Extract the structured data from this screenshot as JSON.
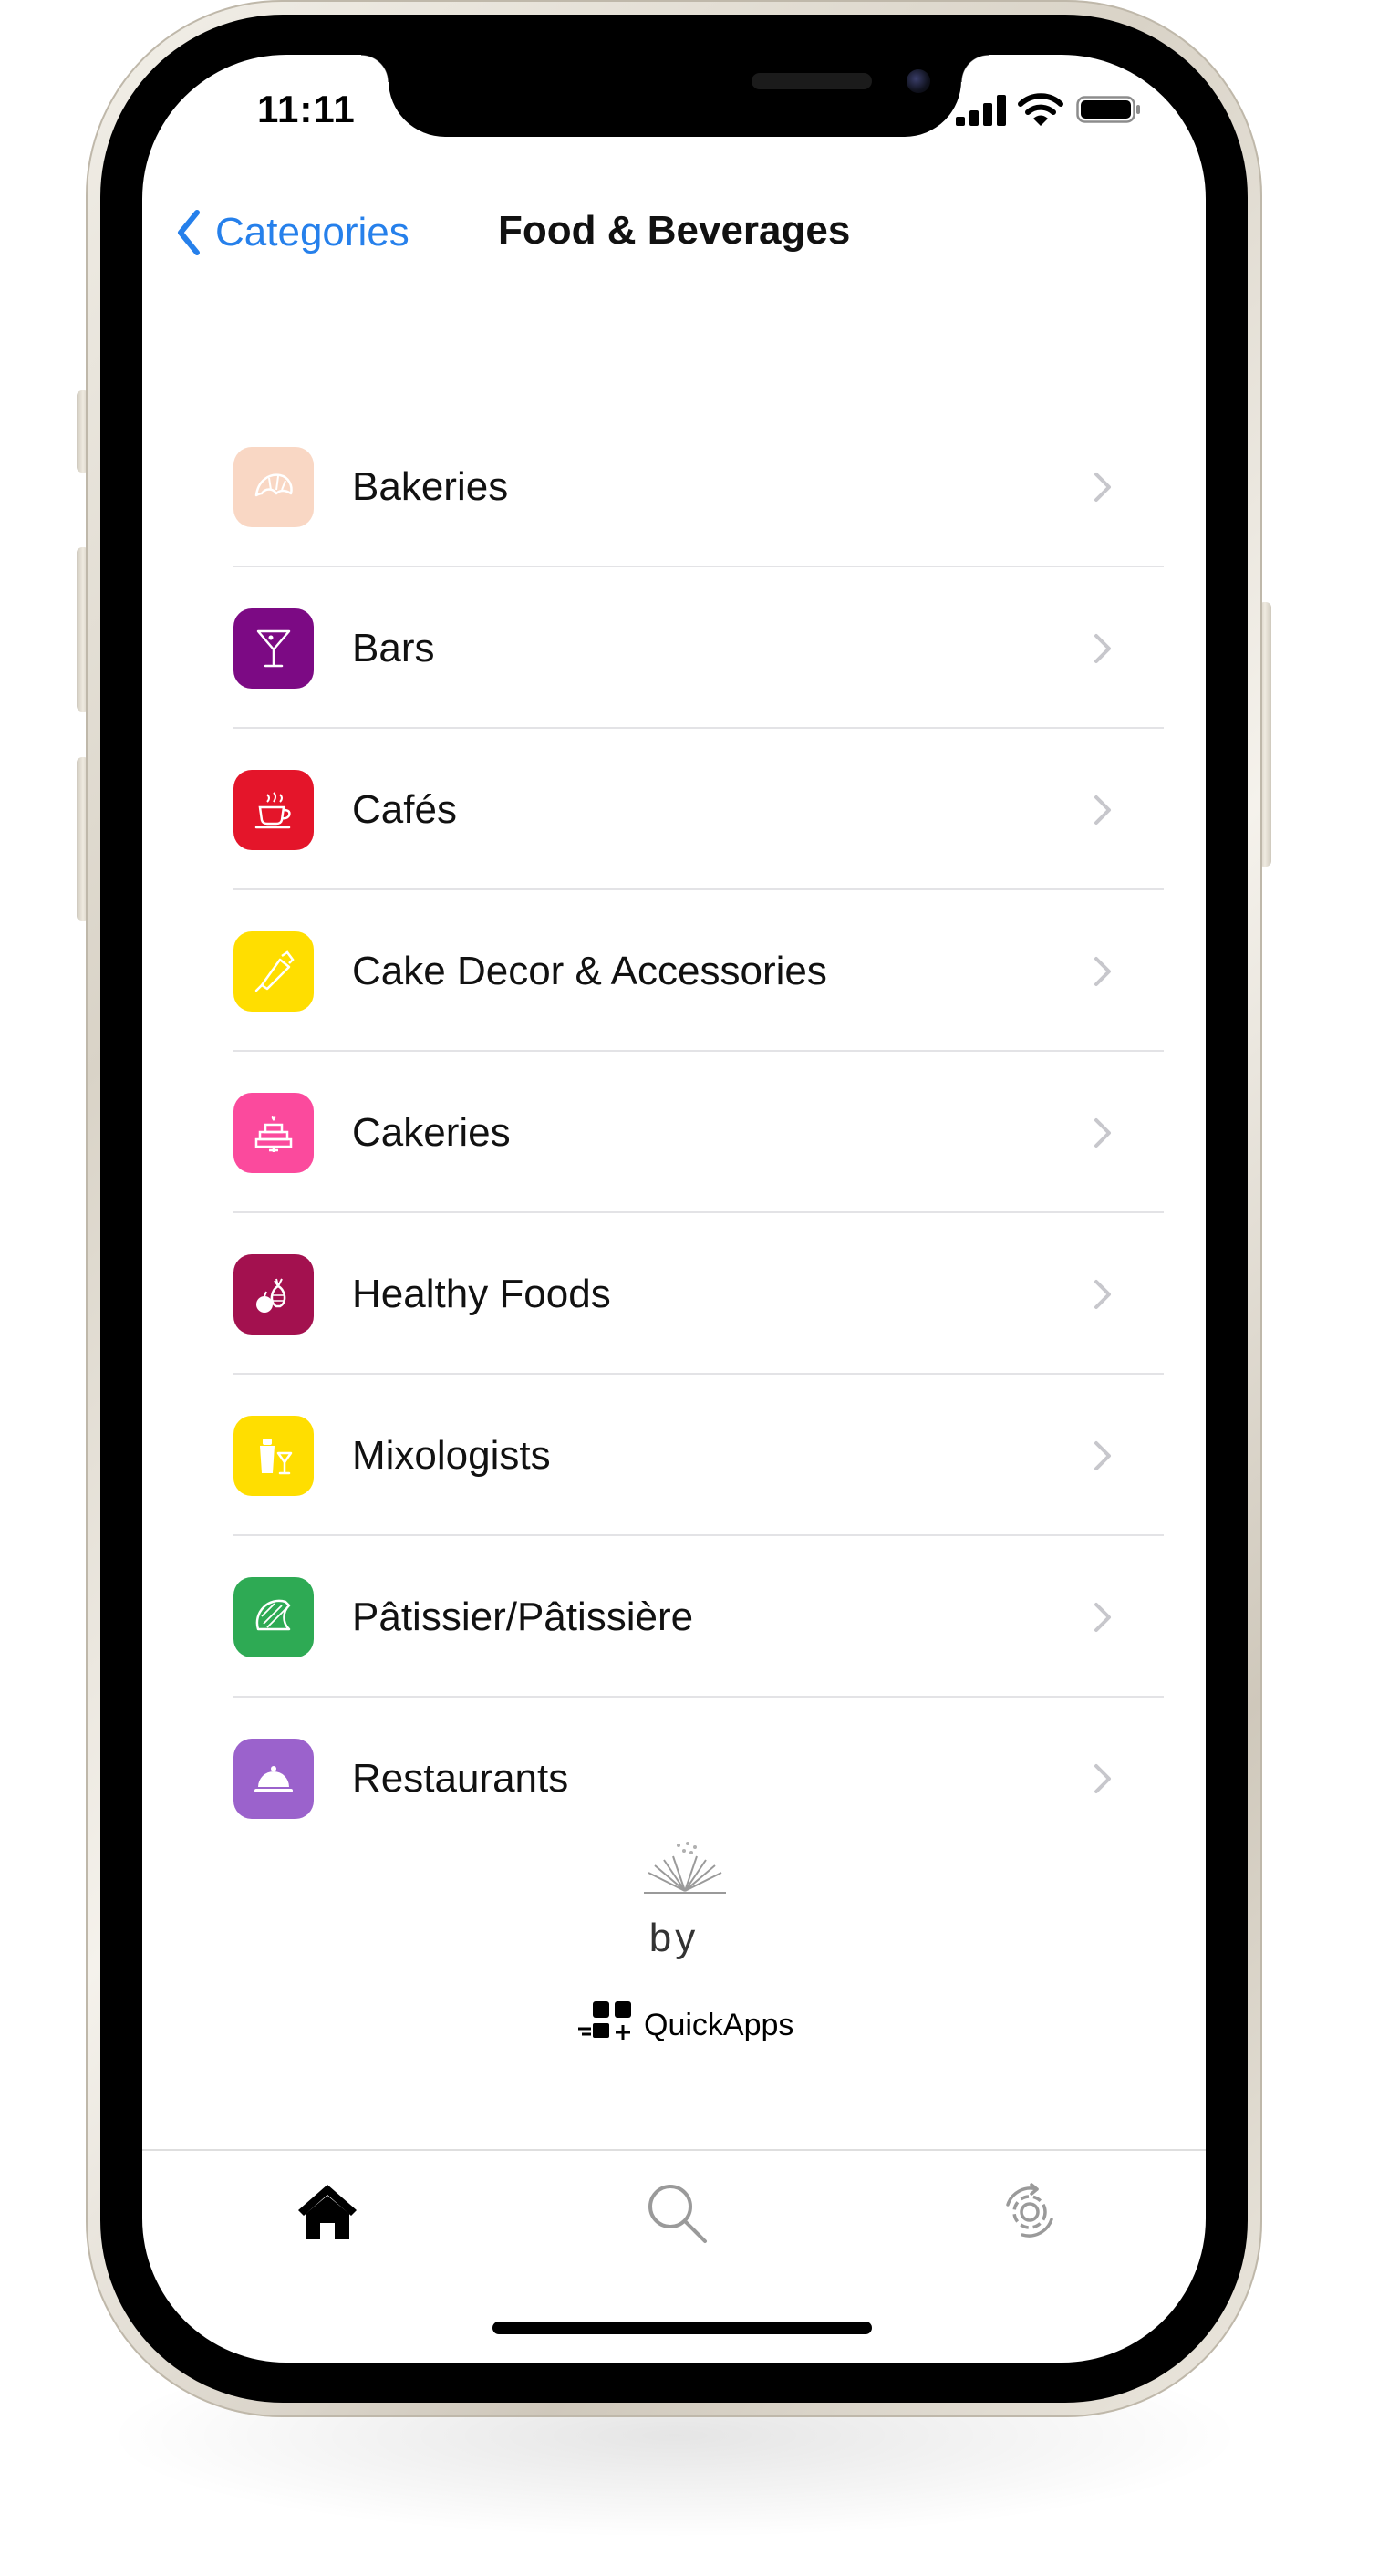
{
  "status_bar": {
    "time": "11:11"
  },
  "nav": {
    "back_label": "Categories",
    "title": "Food & Beverages"
  },
  "categories": [
    {
      "label": "Bakeries",
      "icon": "croissant-icon",
      "color": "#f9d7c4"
    },
    {
      "label": "Bars",
      "icon": "cocktail-glass-icon",
      "color": "#7c0a84"
    },
    {
      "label": "Cafés",
      "icon": "coffee-cup-icon",
      "color": "#e4152a"
    },
    {
      "label": "Cake Decor & Accessories",
      "icon": "piping-bag-icon",
      "color": "#ffde00"
    },
    {
      "label": "Cakeries",
      "icon": "tiered-cake-icon",
      "color": "#fb4a9d"
    },
    {
      "label": "Healthy Foods",
      "icon": "fruit-icon",
      "color": "#a3114f"
    },
    {
      "label": "Mixologists",
      "icon": "shaker-icon",
      "color": "#ffde00"
    },
    {
      "label": "Pâtissier/Pâtissière",
      "icon": "pastry-icon",
      "color": "#2eaa54"
    },
    {
      "label": "Restaurants",
      "icon": "cloche-icon",
      "color": "#9b62cc"
    }
  ],
  "footer": {
    "by": "by",
    "brand": "QuickApps"
  },
  "tabs": [
    {
      "icon": "home-icon",
      "active": true
    },
    {
      "icon": "search-icon",
      "active": false
    },
    {
      "icon": "settings-icon",
      "active": false
    }
  ],
  "colors": {
    "accent": "#2680eb",
    "chevron": "#c7c7cc",
    "separator": "#e3e3e6"
  }
}
